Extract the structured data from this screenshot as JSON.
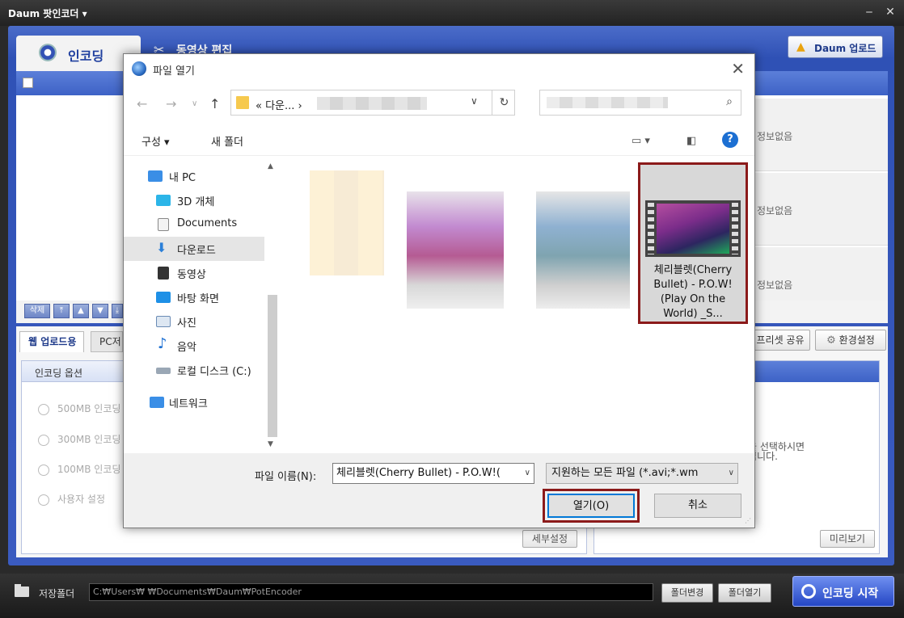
{
  "app": {
    "title": "Daum 팟인코더 ▾",
    "minimize": "‒",
    "close": "✕",
    "tabs": {
      "encoding": "인코딩",
      "video_edit": "동영상 편집"
    },
    "daum_upload": "Daum 업로드",
    "no_info": "정보없음",
    "list_controls": [
      "삭제",
      "⤒",
      "▲",
      "▼",
      "⤓"
    ],
    "sub_tabs": {
      "web_upload": "웹 업로드용",
      "pc": "PC저"
    },
    "preset_share": "프리셋 공유",
    "settings": "환경설정",
    "encoding_options": {
      "header": "인코딩 옵션",
      "options": [
        "500MB 인코딩",
        "300MB 인코딩",
        "100MB 인코딩",
        "사용자 설정"
      ]
    },
    "detail_settings": "세부설정",
    "preview": "미리보기",
    "info_message_1": "을 선택하시면",
    "info_message_2": "됩니다.",
    "save_folder_label": "저장폴더",
    "save_path": "C:₩Users₩        ₩Documents₩Daum₩PotEncoder",
    "change_folder": "폴더변경",
    "open_folder": "폴더열기",
    "start_encoding": "인코딩 시작"
  },
  "dialog": {
    "title": "파일 열기",
    "address_path": "«  다운...  ›",
    "commands": {
      "organize": "구성 ▾",
      "new_folder": "새 폴더"
    },
    "tree": [
      {
        "label": "내 PC",
        "icon": "pc-icon"
      },
      {
        "label": "3D 개체",
        "icon": "cube-icon"
      },
      {
        "label": "Documents",
        "icon": "document-icon"
      },
      {
        "label": "다운로드",
        "icon": "download-icon"
      },
      {
        "label": "동영상",
        "icon": "film-icon"
      },
      {
        "label": "바탕 화면",
        "icon": "desktop-icon"
      },
      {
        "label": "사진",
        "icon": "picture-icon"
      },
      {
        "label": "음악",
        "icon": "music-icon"
      },
      {
        "label": "로컬 디스크 (C:)",
        "icon": "disk-icon"
      },
      {
        "label": "네트워크",
        "icon": "network-icon"
      }
    ],
    "selected_file_label": "체리블렛(Cherry Bullet) - P.O.W!(Play On the World) _S...",
    "file_name_label": "파일 이름(N):",
    "file_name_value": "체리블렛(Cherry Bullet) - P.O.W!(",
    "file_type_value": "지원하는 모든 파일 (*.avi;*.wm",
    "open_button": "열기(O)",
    "cancel_button": "취소"
  }
}
